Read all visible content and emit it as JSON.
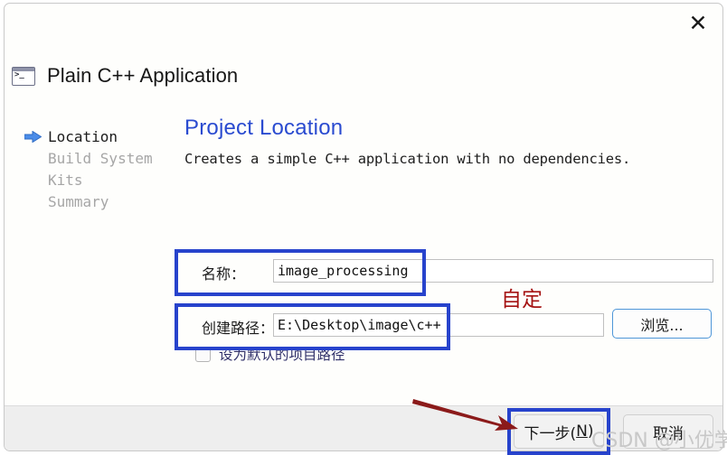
{
  "window": {
    "close_icon": "close-icon",
    "close_glyph": "✕"
  },
  "app": {
    "icon": "terminal-icon",
    "title": "Plain C++ Application"
  },
  "steps": {
    "items": [
      {
        "label": "Location",
        "state": "active"
      },
      {
        "label": "Build System",
        "state": "inactive"
      },
      {
        "label": "Kits",
        "state": "inactive"
      },
      {
        "label": "Summary",
        "state": "inactive"
      }
    ]
  },
  "main": {
    "title": "Project Location",
    "description": "Creates a simple C++ application with no dependencies."
  },
  "form": {
    "name_label": "名称：",
    "name_value": "image_processing",
    "name_placeholder": "",
    "path_label": "创建路径：",
    "path_value": "E:\\Desktop\\image\\c++",
    "path_placeholder": "",
    "browse_label": "浏览...",
    "default_checkbox_label": "设为默认的项目路径",
    "default_checkbox_checked": "false"
  },
  "footer": {
    "next_label_main": "下一步(",
    "next_mnemonic": "N",
    "next_label_end": ")",
    "cancel_label": "取消"
  },
  "annotations": {
    "note_text": "自定",
    "box_color": "#2743cc",
    "note_color": "#a51313",
    "arrow_color": "#8b1a1a",
    "watermark": "CSDN @小优学长"
  },
  "colors": {
    "title_blue": "#2a4bd0",
    "body_bg": "#fefefc",
    "footer_bg": "#eeeeee",
    "step_inactive": "#a6a6a6"
  }
}
